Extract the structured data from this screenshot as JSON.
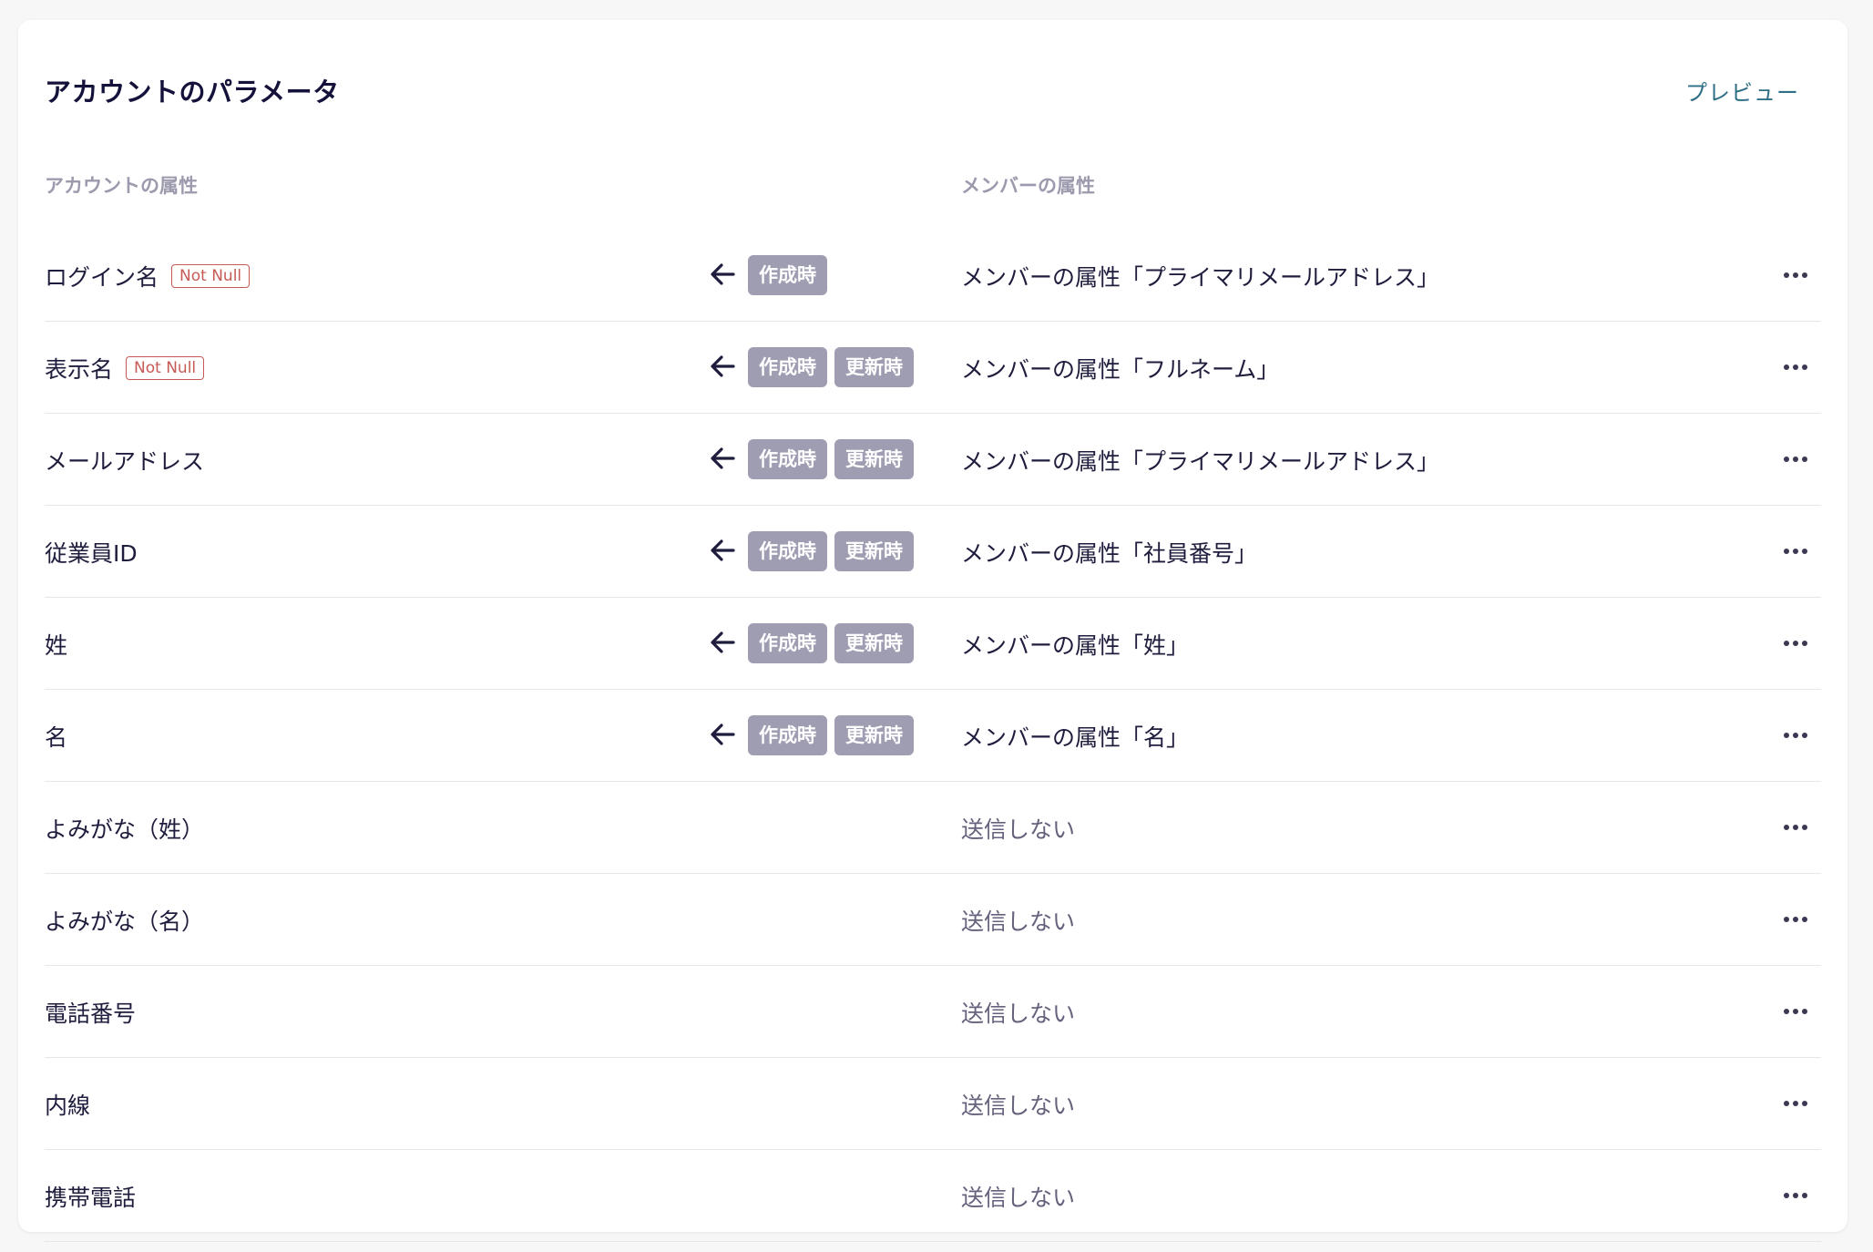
{
  "header": {
    "title": "アカウントのパラメータ",
    "preview_label": "プレビュー"
  },
  "columns": {
    "account_attr": "アカウントの属性",
    "member_attr": "メンバーの属性"
  },
  "badges": {
    "create": "作成時",
    "update": "更新時"
  },
  "colors": {
    "accent_link": "#2f6f86",
    "not_null": "#c65b55",
    "badge_bg": "#9f9db2"
  },
  "rows": [
    {
      "name": "ログイン名",
      "not_null": "Not Null",
      "mapped": "メンバーの属性「プライマリメールアドレス」"
    },
    {
      "name": "表示名",
      "not_null": "Not Null",
      "mapped": "メンバーの属性「フルネーム」"
    },
    {
      "name": "メールアドレス",
      "not_null": "",
      "mapped": "メンバーの属性「プライマリメールアドレス」"
    },
    {
      "name": "従業員ID",
      "not_null": "",
      "mapped": "メンバーの属性「社員番号」"
    },
    {
      "name": "姓",
      "not_null": "",
      "mapped": "メンバーの属性「姓」"
    },
    {
      "name": "名",
      "not_null": "",
      "mapped": "メンバーの属性「名」"
    },
    {
      "name": "よみがな（姓）",
      "not_null": "",
      "mapped": "送信しない"
    },
    {
      "name": "よみがな（名）",
      "not_null": "",
      "mapped": "送信しない"
    },
    {
      "name": "電話番号",
      "not_null": "",
      "mapped": "送信しない"
    },
    {
      "name": "内線",
      "not_null": "",
      "mapped": "送信しない"
    },
    {
      "name": "携帯電話",
      "not_null": "",
      "mapped": "送信しない"
    }
  ]
}
